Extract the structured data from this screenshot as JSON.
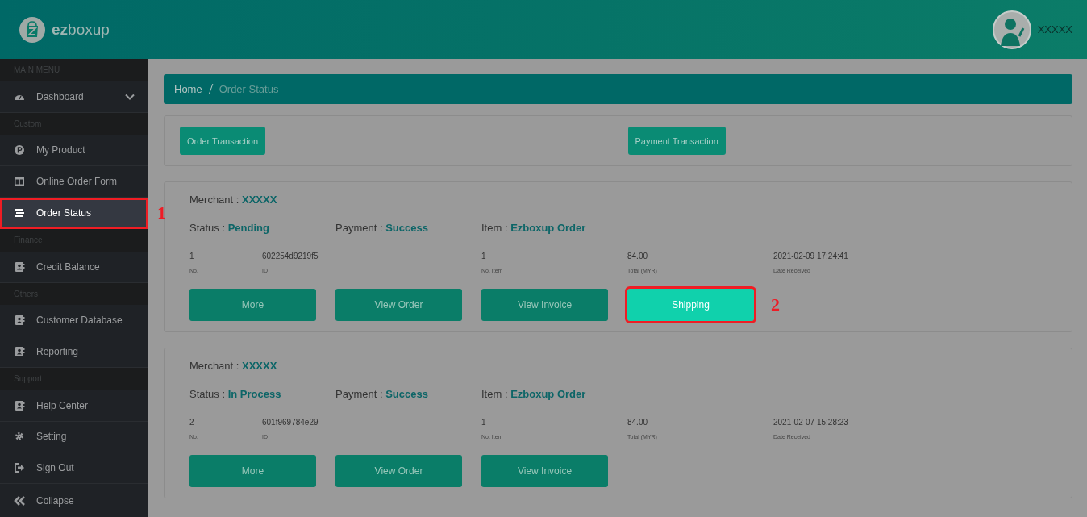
{
  "header": {
    "logo_text": "**ez**boxup",
    "user_name": "XXXXX"
  },
  "sidebar": {
    "items": [
      {
        "kind": "heading",
        "label": "MAIN MENU"
      },
      {
        "kind": "item",
        "label": "Dashboard",
        "expandable": true,
        "highlighted": false
      },
      {
        "kind": "heading",
        "label": "Custom"
      },
      {
        "kind": "item",
        "label": "My Product",
        "highlighted": false
      },
      {
        "kind": "item",
        "label": "Online Order Form",
        "highlighted": false
      },
      {
        "kind": "item",
        "label": "Order Status",
        "highlighted": true,
        "callout": "1"
      },
      {
        "kind": "heading",
        "label": "Finance"
      },
      {
        "kind": "item",
        "label": "Credit Balance",
        "highlighted": false
      },
      {
        "kind": "heading",
        "label": "Others"
      },
      {
        "kind": "item",
        "label": "Customer Database",
        "highlighted": false
      },
      {
        "kind": "item",
        "label": "Reporting",
        "highlighted": false
      },
      {
        "kind": "heading",
        "label": "Support"
      },
      {
        "kind": "item",
        "label": "Help Center",
        "highlighted": false
      },
      {
        "kind": "item",
        "label": "Setting",
        "highlighted": false
      },
      {
        "kind": "item",
        "label": "Sign Out",
        "highlighted": false
      },
      {
        "kind": "collapse",
        "label": "Collapse"
      }
    ]
  },
  "breadcrumb": [
    "Home",
    "Order Status"
  ],
  "transaction_buttons": [
    "Order Transaction",
    "Payment Transaction"
  ],
  "orders": [
    {
      "merchant_label": "Merchant :",
      "merchant": "XXXXX",
      "status_label": "Status :",
      "status": "Pending",
      "payment_label": "Payment :",
      "payment": "Success",
      "item_label": "Item :",
      "item": "Ezboxup Order",
      "fields": [
        {
          "value": "1",
          "label": "No."
        },
        {
          "value": "602254d9219f5",
          "label": "ID"
        },
        {
          "value": "1",
          "label": "No. Item"
        },
        {
          "value": "84.00",
          "label": "Total (MYR)"
        },
        {
          "value": "2021-02-09 17:24:41",
          "label": "Date Received"
        }
      ],
      "buttons": [
        {
          "label": "More",
          "highlighted": false
        },
        {
          "label": "View Order",
          "highlighted": false
        },
        {
          "label": "View Invoice",
          "highlighted": false
        },
        {
          "label": "Shipping",
          "highlighted": true,
          "callout": "2"
        }
      ]
    },
    {
      "merchant_label": "Merchant :",
      "merchant": "XXXXX",
      "status_label": "Status :",
      "status": "In Process",
      "payment_label": "Payment :",
      "payment": "Success",
      "item_label": "Item :",
      "item": "Ezboxup Order",
      "fields": [
        {
          "value": "2",
          "label": "No."
        },
        {
          "value": "601f969784e29",
          "label": "ID"
        },
        {
          "value": "1",
          "label": "No. Item"
        },
        {
          "value": "84.00",
          "label": "Total (MYR)"
        },
        {
          "value": "2021-02-07 15:28:23",
          "label": "Date Received"
        }
      ],
      "buttons": [
        {
          "label": "More",
          "highlighted": false
        },
        {
          "label": "View Order",
          "highlighted": false
        },
        {
          "label": "View Invoice",
          "highlighted": false
        }
      ]
    }
  ]
}
